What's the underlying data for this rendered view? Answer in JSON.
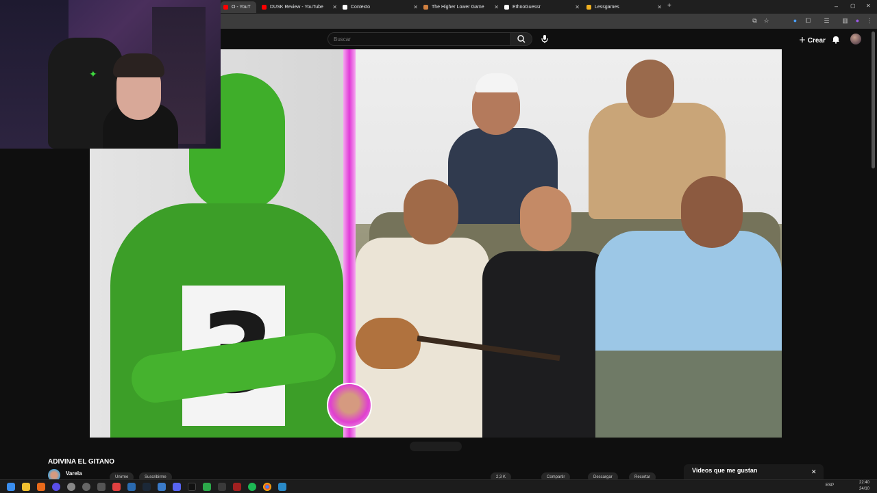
{
  "browser": {
    "tabs": [
      {
        "label": "O - YouT",
        "color": "#ff0000",
        "active": true
      },
      {
        "label": "DUSK Review - YouTube",
        "color": "#ff0000"
      },
      {
        "label": "Contexto",
        "color": "#ffffff"
      },
      {
        "label": "The Higher Lower Game",
        "color": "#d08040"
      },
      {
        "label": "EthnoGuessr",
        "color": "#ffffff"
      },
      {
        "label": "Lessgames",
        "color": "#f0b020"
      }
    ],
    "new_tab_label": "+",
    "window_controls": {
      "minimize": "–",
      "maximize": "▢",
      "close": "✕"
    }
  },
  "youtube": {
    "search_placeholder": "Buscar",
    "create_label": "Crear",
    "video_title": "ADIVINA EL GITANO",
    "channel_name": "Varela",
    "subscribe_labels": [
      "Unirme",
      "Suscribirme"
    ],
    "action_labels": [
      "2,3 K",
      "Compartir",
      "Descargar",
      "Recortar"
    ],
    "panel_title": "Videos que me gustan",
    "video_overlay_number": "3"
  },
  "taskbar": {
    "language": "ESP",
    "time": "22:40",
    "date": "24/10"
  },
  "colors": {
    "accent_pink": "#e03ad6",
    "suit_green": "#3fae2a",
    "youtube_red": "#ff0000"
  }
}
